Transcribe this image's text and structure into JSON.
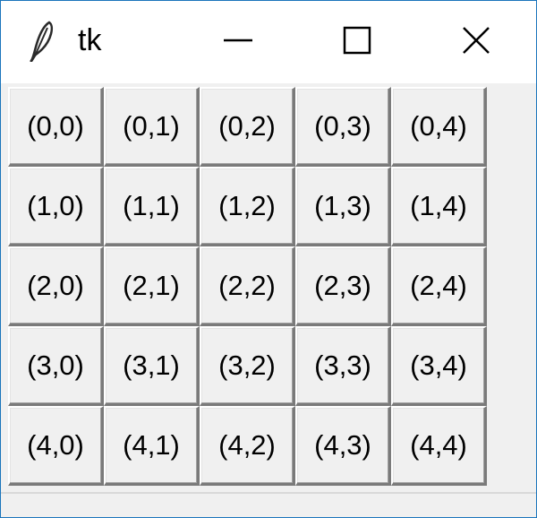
{
  "window": {
    "title": "tk",
    "icon": "feather-icon",
    "controls": {
      "minimize_icon": "minimize-icon",
      "maximize_icon": "maximize-icon",
      "close_icon": "close-icon"
    }
  },
  "grid": {
    "rows": [
      [
        "(0,0)",
        "(0,1)",
        "(0,2)",
        "(0,3)",
        "(0,4)"
      ],
      [
        "(1,0)",
        "(1,1)",
        "(1,2)",
        "(1,3)",
        "(1,4)"
      ],
      [
        "(2,0)",
        "(2,1)",
        "(2,2)",
        "(2,3)",
        "(2,4)"
      ],
      [
        "(3,0)",
        "(3,1)",
        "(3,2)",
        "(3,3)",
        "(3,4)"
      ],
      [
        "(4,0)",
        "(4,1)",
        "(4,2)",
        "(4,3)",
        "(4,4)"
      ]
    ]
  }
}
